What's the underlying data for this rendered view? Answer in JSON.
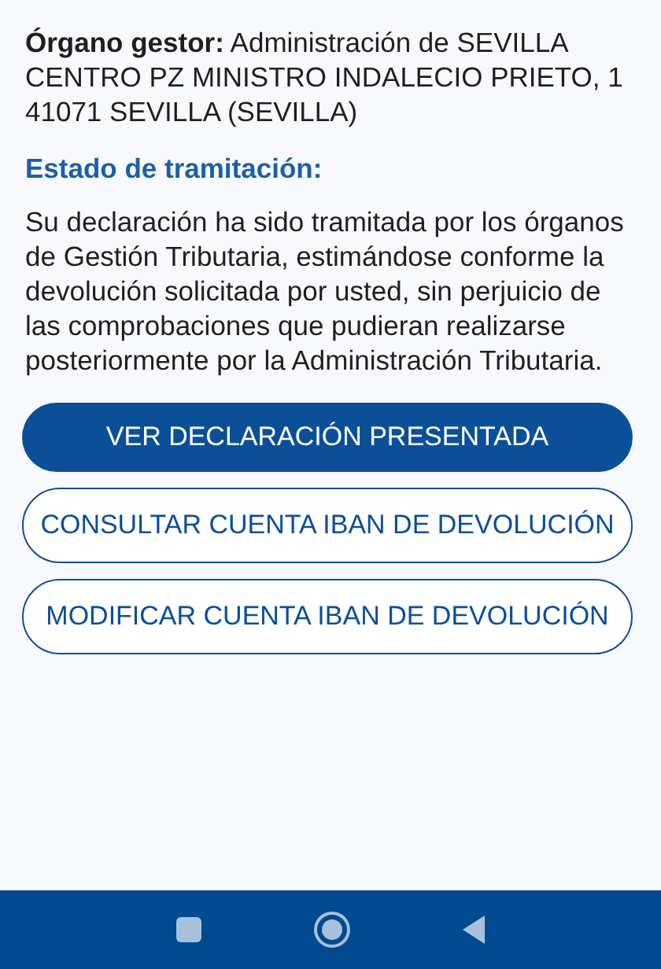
{
  "organo_gestor": "**Órgano gestor:** Administración de SEVILLA CENTRO  PZ MINISTRO INDALECIO PRIETO, 1 41071 SEVILLA (SEVILLA)",
  "estado_label": "Estado de tramitación:",
  "estado_text": "Su declaración ha sido tramitada por los órganos de Gestión Tributaria, estimándose conforme la devolución solicitada por usted, sin perjuicio de las comprobaciones que pudieran realizarse posteriormente por la Administración Tributaria.",
  "buttons": [
    {
      "label": "VER DECLARACIÓN PRESENTADA",
      "kind": "filled"
    },
    {
      "label": "CONSULTAR CUENTA IBAN DE DEVOLUCIÓN",
      "kind": "outlined"
    },
    {
      "label": "MODIFICAR CUENTA IBAN DE DEVOLUCIÓN",
      "kind": "outlined"
    }
  ]
}
